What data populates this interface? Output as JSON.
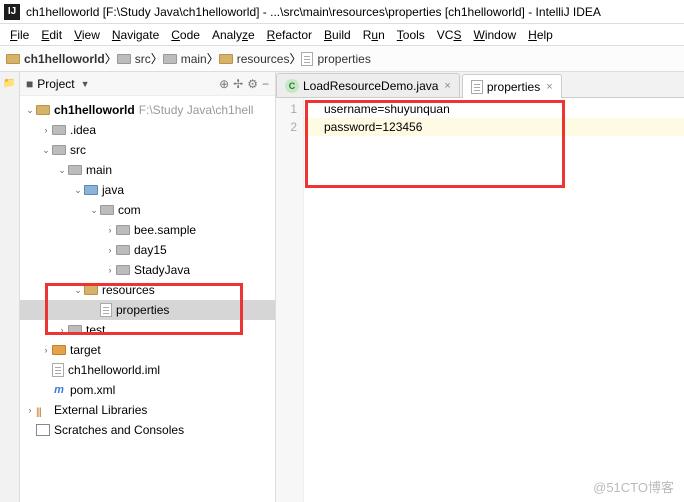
{
  "window": {
    "title": "ch1helloworld [F:\\Study Java\\ch1helloworld] - ...\\src\\main\\resources\\properties [ch1helloworld] - IntelliJ IDEA",
    "icon_label": "IJ"
  },
  "menu": {
    "file": "File",
    "edit": "Edit",
    "view": "View",
    "navigate": "Navigate",
    "code": "Code",
    "analyze": "Analyze",
    "refactor": "Refactor",
    "build": "Build",
    "run": "Run",
    "tools": "Tools",
    "vcs": "VCS",
    "window": "Window",
    "help": "Help"
  },
  "breadcrumb": {
    "seg0": "ch1helloworld",
    "seg1": "src",
    "seg2": "main",
    "seg3": "resources",
    "seg4": "properties"
  },
  "side_strip": {
    "label": "1: Project"
  },
  "project_pane": {
    "title": "Project",
    "tools": {
      "scope": "⊕",
      "collapse": "✢",
      "gear": "⚙",
      "hide": "−"
    }
  },
  "tree": {
    "root": "ch1helloworld",
    "root_path": "F:\\Study Java\\ch1hell",
    "idea": ".idea",
    "src": "src",
    "main": "main",
    "java": "java",
    "com": "com",
    "pkg_bee": "bee.sample",
    "pkg_day15": "day15",
    "pkg_stady": "StadyJava",
    "resources": "resources",
    "properties": "properties",
    "test": "test",
    "target": "target",
    "iml": "ch1helloworld.iml",
    "pom": "pom.xml",
    "ext_lib": "External Libraries",
    "scratches": "Scratches and Consoles"
  },
  "tabs": {
    "tab0": "LoadResourceDemo.java",
    "tab1": "properties"
  },
  "editor": {
    "line1_no": "1",
    "line2_no": "2",
    "line1": "username=shuyunquan",
    "line2": "password=123456"
  },
  "watermark": "@51CTO博客"
}
